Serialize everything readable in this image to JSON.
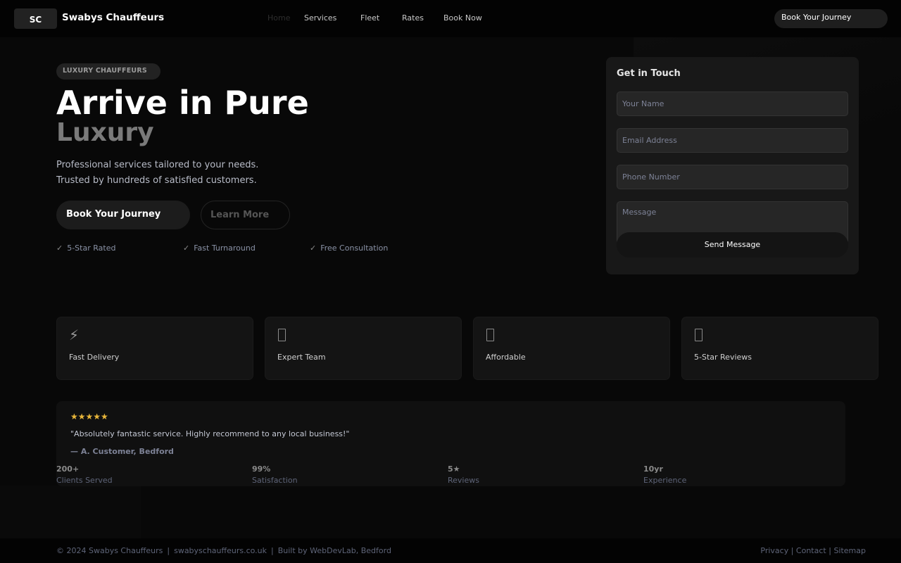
{
  "nav": {
    "logo": "SC",
    "brand": "Swabys Chauffeurs",
    "links": [
      "Home",
      "Services",
      "Fleet",
      "Rates",
      "Book Now"
    ],
    "cta": "Book Your Journey"
  },
  "hero": {
    "badge": "LUXURY CHAUFFEURS",
    "title": "Arrive in Pure",
    "subtitle": "Luxury",
    "desc_line1": "Professional services tailored to your needs.",
    "desc_line2": "Trusted by hundreds of satisfied customers.",
    "primary_button": "Book Your Journey",
    "secondary_button": "Learn More",
    "check_icon": "✓",
    "features": [
      "5-Star Rated",
      "Fast Turnaround",
      "Free Consultation"
    ]
  },
  "contact": {
    "title": "Get in Touch",
    "name_placeholder": "Your Name",
    "email_placeholder": "Email Address",
    "phone_placeholder": "Phone Number",
    "message_placeholder": "Message",
    "submit": "Send Message"
  },
  "feature_cards": [
    {
      "icon": "lightning-icon",
      "glyph": "⚡",
      "label": "Fast Delivery"
    },
    {
      "icon": "team-icon",
      "label": "Expert Team"
    },
    {
      "icon": "price-icon",
      "label": "Affordable"
    },
    {
      "icon": "star-icon",
      "label": "5-Star Reviews"
    }
  ],
  "testimonial": {
    "stars": "★★★★★",
    "quote": "\"Absolutely fantastic service. Highly recommend to any local business!\"",
    "author": "— A. Customer, Bedford",
    "star_color": "#e8b63a"
  },
  "stats": [
    {
      "value": "200+",
      "label": "Clients Served"
    },
    {
      "value": "99%",
      "label": "Satisfaction"
    },
    {
      "value": "5★",
      "label": "Reviews"
    },
    {
      "value": "10yr",
      "label": "Experience"
    }
  ],
  "footer": {
    "copyright": "© 2024 Swabys Chauffeurs",
    "domain": "swabyschauffeurs.co.uk",
    "credit": "Built by WebDevLab, Bedford",
    "links": [
      "Privacy",
      "Contact",
      "Sitemap"
    ],
    "separator": "|"
  }
}
